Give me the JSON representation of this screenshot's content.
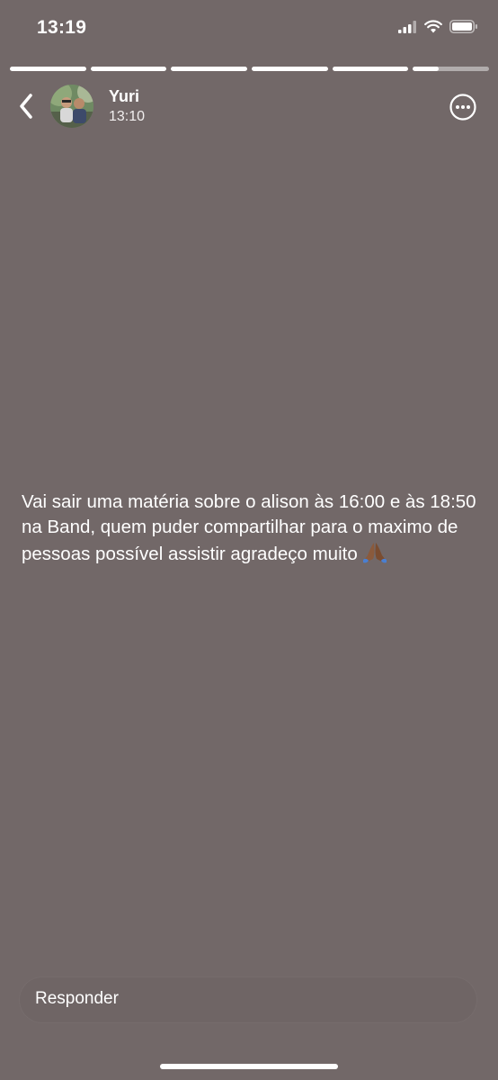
{
  "status_bar": {
    "time": "13:19",
    "icons": [
      "signal-icon",
      "wifi-icon",
      "battery-icon"
    ]
  },
  "story_progress": {
    "segments": [
      1,
      1,
      1,
      1,
      1,
      0.34
    ]
  },
  "header": {
    "user_name": "Yuri",
    "post_time": "13:10",
    "back_icon": "chevron-left-icon",
    "more_icon": "ellipsis-circle-icon"
  },
  "story": {
    "text": "Vai sair uma matéria sobre o alison às 16:00 e às 18:50 na Band, quem puder compartilhar para o maximo de pessoas possível assistir agradeço muito",
    "emoji": "praying-hands-emoji",
    "background_color": "#726868"
  },
  "reply": {
    "label": "Responder"
  }
}
